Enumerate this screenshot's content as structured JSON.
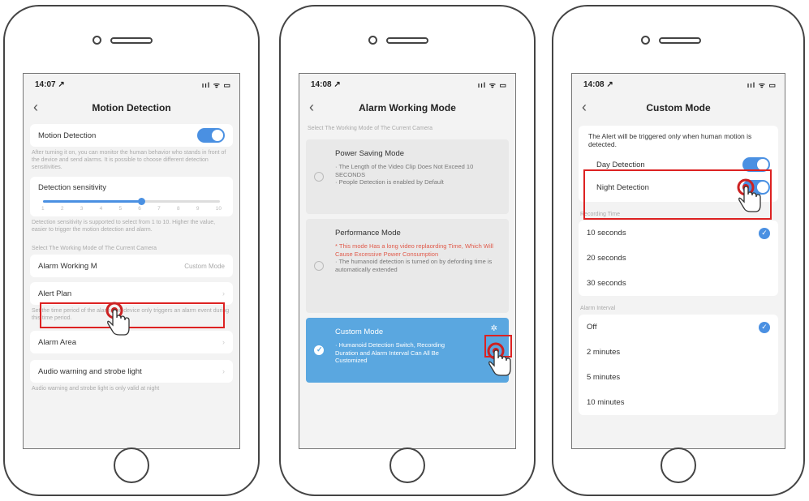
{
  "accent_color": "#4a90e2",
  "highlight_color": "#dd2222",
  "phone1": {
    "time": "14:07 ↗",
    "signal": "ııl ᯤ ▭",
    "title": "Motion Detection",
    "motion_detection_label": "Motion Detection",
    "motion_detection_on": true,
    "motion_note": "After turning it on, you can monitor the human behavior who stands in front of the device and send alarms. It is possible to choose different detection sensitivities.",
    "sensitivity_label": "Detection sensitivity",
    "sensitivity_value": 6,
    "sensitivity_ticks": [
      "1",
      "2",
      "3",
      "4",
      "5",
      "6",
      "7",
      "8",
      "9",
      "10"
    ],
    "sensitivity_note": "Detection sensitivity is supported to select from 1 to 10. Higher the value, easier to trigger the motion detection and alarm.",
    "working_mode_section": "Select The Working Mode of The Current Camera",
    "alarm_working_label": "Alarm Working M",
    "alarm_working_value": "Custom Mode",
    "alert_plan_label": "Alert Plan",
    "alert_plan_note": "Set the time period of the alarm, the device only triggers an alarm event during this time period.",
    "alarm_area_label": "Alarm Area",
    "audio_warning_label": "Audio warning and strobe light",
    "audio_note": "Audio warning and strobe light is only valid at night"
  },
  "phone2": {
    "time": "14:08 ↗",
    "signal": "ııl ᯤ ▭",
    "title": "Alarm Working Mode",
    "section": "Select The Working Mode of The Current Camera",
    "modes": [
      {
        "title": "Power Saving Mode",
        "warn": "",
        "desc": "· The Length of the Video Clip Does Not Exceed 10 SECONDS\n· People Detection is enabled by Default"
      },
      {
        "title": "Performance Mode",
        "warn": "* This mode Has a long video replaording Time, Which Will Cause Excessive Power Consumption",
        "desc": "· The humanoid detection is turned on by defording time is automatically extended"
      },
      {
        "title": "Custom Mode",
        "warn": "",
        "desc": "· Humanoid Detection Switch, Recording Duration and Alarm Interval Can All Be Customized"
      }
    ]
  },
  "phone3": {
    "time": "14:08 ↗",
    "signal": "ııl ᯤ ▭",
    "title": "Custom Mode",
    "alert_note": "The Alert will be triggered only when human motion is detected.",
    "day_detection_label": "Day Detection",
    "night_detection_label": "Night Detection",
    "recording_section": "Recording Time",
    "recording_options": [
      "10 seconds",
      "20 seconds",
      "30 seconds"
    ],
    "recording_selected": "10 seconds",
    "interval_section": "Alarm Interval",
    "interval_options": [
      "Off",
      "2 minutes",
      "5 minutes",
      "10 minutes"
    ],
    "interval_selected": "Off"
  }
}
